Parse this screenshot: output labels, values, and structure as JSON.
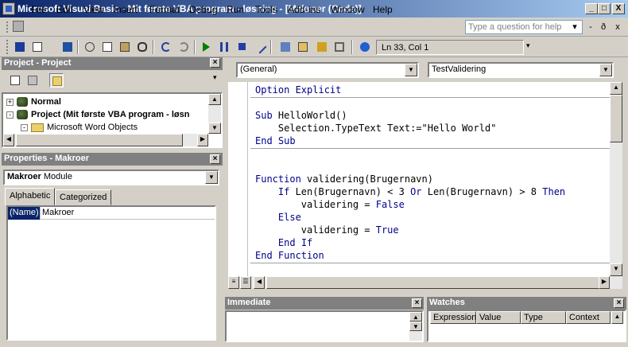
{
  "window": {
    "title": "Microsoft Visual Basic - Mit første VBA program - løsning - [Makroer (Code)]",
    "minimize_glyph": "_",
    "restore_glyph": "□",
    "close_glyph": "X"
  },
  "menu": {
    "items": [
      "File",
      "Edit",
      "View",
      "Insert",
      "Format",
      "Debug",
      "Run",
      "Tools",
      "Add-Ins",
      "Window",
      "Help"
    ],
    "help_placeholder": "Type a question for help",
    "help_dropdown_glyph": "▾",
    "doc_min_glyph": "-",
    "doc_restore_glyph": "ð",
    "doc_close_glyph": "x"
  },
  "toolbar": {
    "cursor_position": "Ln 33, Col 1"
  },
  "project_panel": {
    "title": "Project - Project",
    "tree": [
      {
        "label": "Normal",
        "expand": "+"
      },
      {
        "label": "Project (Mit første VBA program - løsn",
        "expand": "-"
      },
      {
        "label": "Microsoft Word Objects",
        "expand": "-"
      }
    ]
  },
  "properties_panel": {
    "title": "Properties - Makroer",
    "object_name": "Makroer",
    "object_type": "Module",
    "tabs": [
      "Alphabetic",
      "Categorized"
    ],
    "property_name": "(Name)",
    "property_value": "Makroer"
  },
  "code_window": {
    "object_combo": "(General)",
    "procedure_combo": "TestValidering",
    "lines": [
      "Option Explicit",
      "Sub HelloWorld()",
      "    Selection.TypeText Text:=\"Hello World\"",
      "End Sub",
      "Function validering(Brugernavn)",
      "    If Len(Brugernavn) < 3 Or Len(Brugernavn) > 8 Then",
      "        validering = False",
      "    Else",
      "        validering = True",
      "    End If",
      "End Function"
    ]
  },
  "immediate_panel": {
    "title": "Immediate"
  },
  "watches_panel": {
    "title": "Watches",
    "columns": [
      "Expression",
      "Value",
      "Type",
      "Context"
    ]
  }
}
